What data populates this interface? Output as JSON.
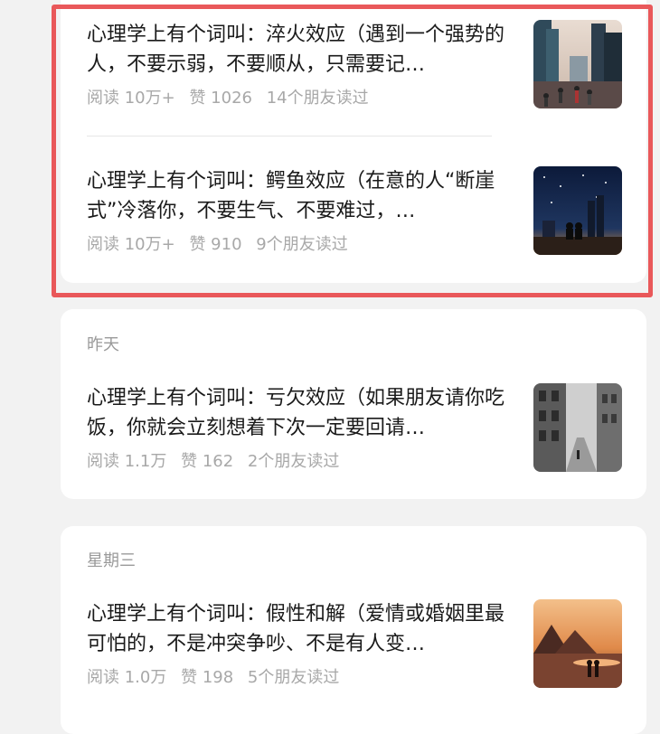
{
  "groups": [
    {
      "date": "",
      "articles": [
        {
          "title": "心理学上有个词叫：淬火效应（遇到一个强势的人，不要示弱，不要顺从，只需要记…",
          "reads": "阅读 10万+",
          "likes": "赞 1026",
          "friends": "14个朋友读过",
          "thumb": "city-street-crowd"
        },
        {
          "title": "心理学上有个词叫：鳄鱼效应（在意的人“断崖式”冷落你，不要生气、不要难过，…",
          "reads": "阅读 10万+",
          "likes": "赞 910",
          "friends": "9个朋友读过",
          "thumb": "couple-starry-night-city"
        }
      ]
    },
    {
      "date": "昨天",
      "articles": [
        {
          "title": "心理学上有个词叫：亏欠效应（如果朋友请你吃饭，你就会立刻想着下次一定要回请…",
          "reads": "阅读 1.1万",
          "likes": "赞 162",
          "friends": "2个朋友读过",
          "thumb": "black-white-street"
        }
      ]
    },
    {
      "date": "星期三",
      "articles": [
        {
          "title": "心理学上有个词叫：假性和解（爱情或婚姻里最可怕的，不是冲突争吵、不是有人变…",
          "reads": "阅读 1.0万",
          "likes": "赞 198",
          "friends": "5个朋友读过",
          "thumb": "couple-beach-sunset"
        }
      ]
    }
  ],
  "colors": {
    "background": "#f2f2f2",
    "card": "#ffffff",
    "highlight": "#e9585a",
    "meta": "#a8a8a8",
    "title": "#1a1a1a"
  }
}
